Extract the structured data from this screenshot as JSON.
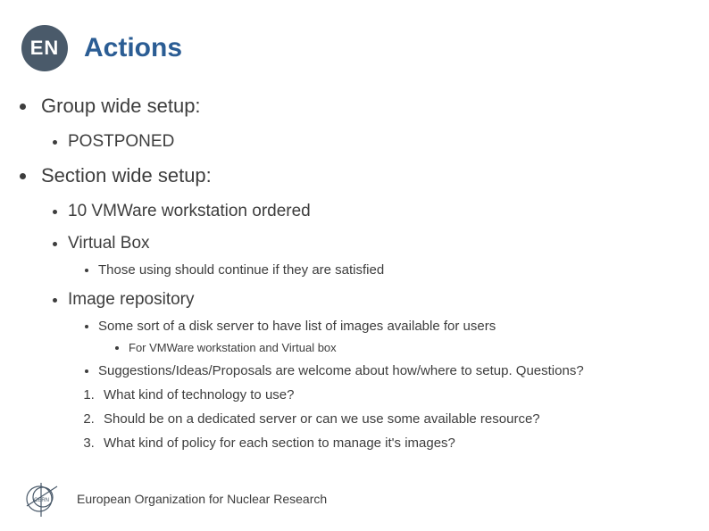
{
  "badge": "EN",
  "title": "Actions",
  "items": {
    "group_setup": "Group wide setup:",
    "group_sub": "POSTPONED",
    "section_setup": "Section wide setup:",
    "vmware": "10 VMWare workstation ordered",
    "virtualbox": "Virtual Box",
    "virtualbox_sub": "Those using should continue if they are satisfied",
    "image_repo": "Image repository",
    "image_repo_sub": "Some sort of a disk server to have list of images available for users",
    "image_repo_sub2": "For VMWare workstation and Virtual box",
    "suggestions": "Suggestions/Ideas/Proposals are welcome about how/where to setup. Questions?",
    "q1": "What kind of technology to use?",
    "q2": "Should be on a dedicated server or can we use some available resource?",
    "q3": "What kind of policy for each section to manage it's images?"
  },
  "footer": "European Organization for Nuclear Research"
}
